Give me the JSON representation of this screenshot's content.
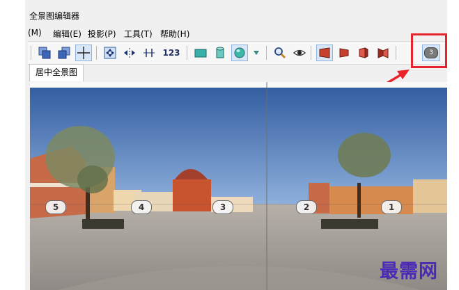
{
  "window": {
    "title": "全景图编辑器"
  },
  "menu": {
    "items": [
      "(M)",
      "编辑(E)",
      "投影(P)",
      "工具(T)",
      "帮助(H)"
    ]
  },
  "toolbar": {
    "text_label": "123",
    "highlighted_button_value": "3",
    "buttons": [
      "layers-front-icon",
      "layers-back-icon",
      "crosshair-icon",
      "move-all-icon",
      "move-horizontal-icon",
      "move-vertical-icon",
      "number-labels-button",
      "flat-rectangle-icon",
      "cylinder-icon",
      "sphere-icon",
      "dropdown-arrow-icon",
      "zoom-icon",
      "eye-icon",
      "projection-1-icon",
      "projection-2-icon",
      "projection-3-icon",
      "projection-4-icon",
      "hotspot-number-button"
    ]
  },
  "tabs": [
    {
      "label": "居中全景图",
      "active": true
    }
  ],
  "panorama": {
    "hotspots": [
      "5",
      "4",
      "3",
      "2",
      "1"
    ]
  },
  "watermark": "最需网",
  "colors": {
    "highlight": "#e8242a",
    "arrow": "#e8242a",
    "watermark": "#4b2ab5",
    "sky_top": "#2f5a9e"
  }
}
